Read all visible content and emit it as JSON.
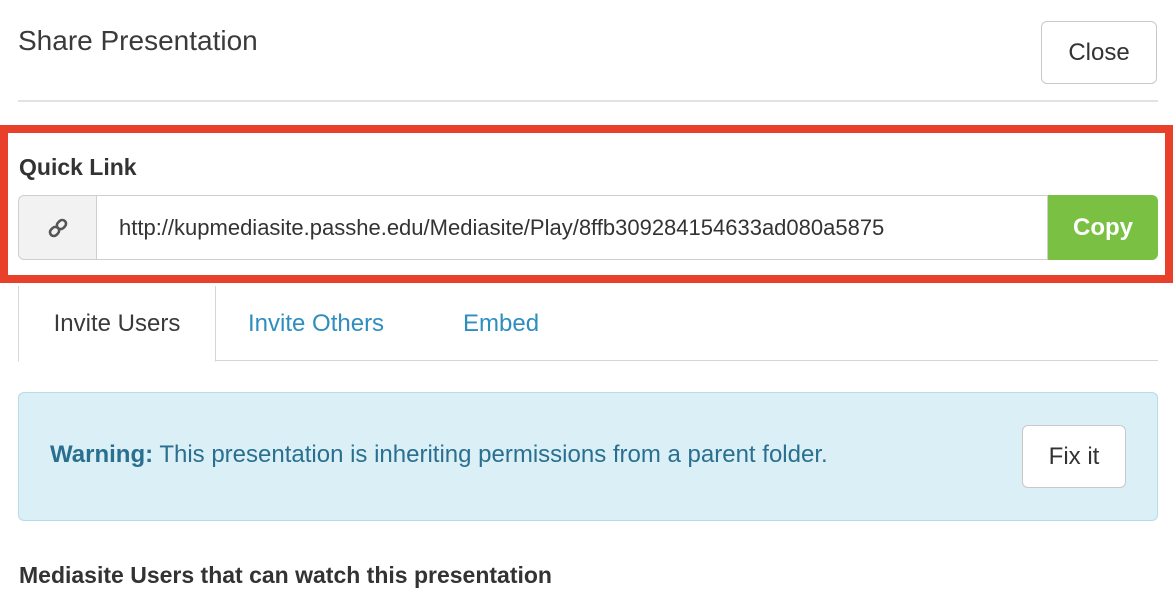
{
  "header": {
    "title": "Share Presentation",
    "close_label": "Close"
  },
  "quick_link": {
    "label": "Quick Link",
    "url": "http://kupmediasite.passhe.edu/Mediasite/Play/8ffb309284154633ad080a5875",
    "copy_label": "Copy",
    "addon_icon": "link-icon"
  },
  "tabs": [
    {
      "label": "Invite Users",
      "active": true
    },
    {
      "label": "Invite Others",
      "active": false
    },
    {
      "label": "Embed",
      "active": false
    }
  ],
  "alert": {
    "strong": "Warning:",
    "message": " This presentation is inheriting permissions from a parent folder.",
    "fix_label": "Fix it"
  },
  "section": {
    "heading": "Mediasite Users that can watch this presentation"
  },
  "colors": {
    "highlight": "#e8402a",
    "copy": "#7ac143",
    "tab_link": "#2e8ec0",
    "alert_bg": "#dbeff6"
  }
}
